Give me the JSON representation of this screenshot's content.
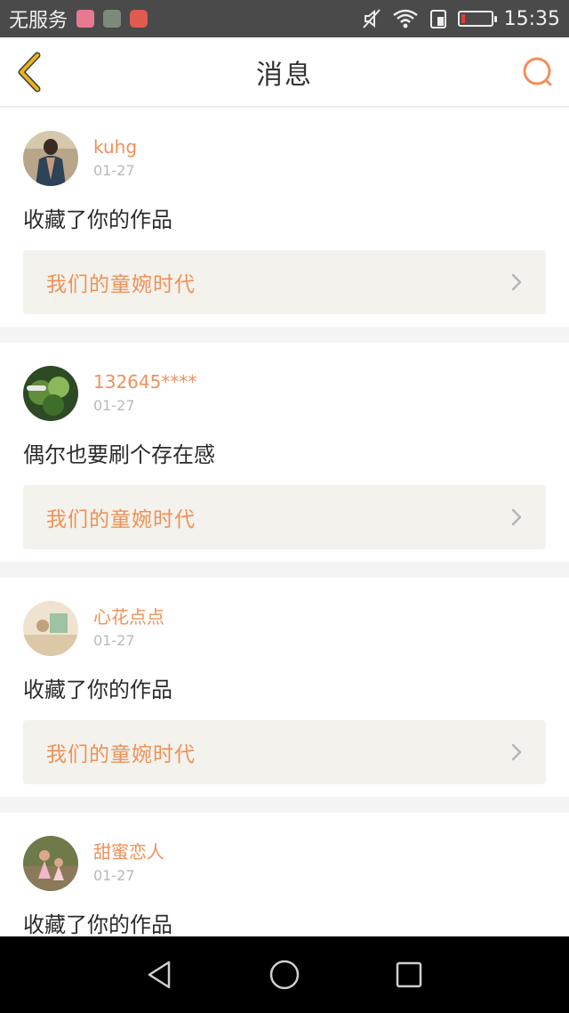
{
  "status_bar": {
    "carrier": "无服务",
    "time": "15:35"
  },
  "header": {
    "title": "消息"
  },
  "colors": {
    "accent": "#f0905a",
    "back_icon": "#e8b41a"
  },
  "messages": [
    {
      "user": "kuhg",
      "date": "01-27",
      "text": "收藏了你的作品",
      "work_title": "我们的童婉时代"
    },
    {
      "user": "132645****",
      "date": "01-27",
      "text": "偶尔也要刷个存在感",
      "work_title": "我们的童婉时代"
    },
    {
      "user": "心花点点",
      "date": "01-27",
      "text": "收藏了你的作品",
      "work_title": "我们的童婉时代"
    },
    {
      "user": "甜蜜恋人",
      "date": "01-27",
      "text": "收藏了你的作品",
      "work_title": ""
    }
  ],
  "icons": {
    "back": "chevron-left-icon",
    "search": "search-icon",
    "nav_back": "triangle-back-icon",
    "nav_home": "circle-home-icon",
    "nav_recent": "square-recent-icon"
  }
}
